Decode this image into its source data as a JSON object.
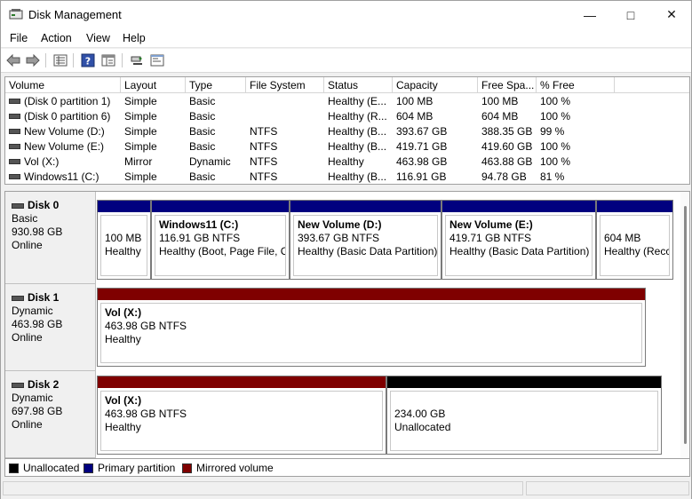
{
  "window": {
    "title": "Disk Management",
    "minimize_glyph": "—",
    "maximize_glyph": "□",
    "close_glyph": "✕"
  },
  "menu": {
    "file": "File",
    "action": "Action",
    "view": "View",
    "help": "Help"
  },
  "toolbar": {
    "icons": [
      "back-icon",
      "forward-icon",
      "list-view-icon",
      "help-icon",
      "properties-icon",
      "connect-icon",
      "console-icon"
    ]
  },
  "volume_list": {
    "columns": [
      "Volume",
      "Layout",
      "Type",
      "File System",
      "Status",
      "Capacity",
      "Free Spa...",
      "% Free"
    ],
    "rows": [
      {
        "volume": "(Disk 0 partition 1)",
        "layout": "Simple",
        "type": "Basic",
        "fs": "",
        "status": "Healthy (E...",
        "capacity": "100 MB",
        "free": "100 MB",
        "pct": "100 %"
      },
      {
        "volume": "(Disk 0 partition 6)",
        "layout": "Simple",
        "type": "Basic",
        "fs": "",
        "status": "Healthy (R...",
        "capacity": "604 MB",
        "free": "604 MB",
        "pct": "100 %"
      },
      {
        "volume": "New Volume (D:)",
        "layout": "Simple",
        "type": "Basic",
        "fs": "NTFS",
        "status": "Healthy (B...",
        "capacity": "393.67 GB",
        "free": "388.35 GB",
        "pct": "99 %"
      },
      {
        "volume": "New Volume (E:)",
        "layout": "Simple",
        "type": "Basic",
        "fs": "NTFS",
        "status": "Healthy (B...",
        "capacity": "419.71 GB",
        "free": "419.60 GB",
        "pct": "100 %"
      },
      {
        "volume": "Vol (X:)",
        "layout": "Mirror",
        "type": "Dynamic",
        "fs": "NTFS",
        "status": "Healthy",
        "capacity": "463.98 GB",
        "free": "463.88 GB",
        "pct": "100 %"
      },
      {
        "volume": "Windows11 (C:)",
        "layout": "Simple",
        "type": "Basic",
        "fs": "NTFS",
        "status": "Healthy (B...",
        "capacity": "116.91 GB",
        "free": "94.78 GB",
        "pct": "81 %"
      }
    ]
  },
  "disks": [
    {
      "name": "Disk 0",
      "type": "Basic",
      "size": "930.98 GB",
      "state": "Online",
      "partitions": [
        {
          "name": "",
          "detail": "100 MB",
          "status": "Healthy",
          "color": "#00007f"
        },
        {
          "name": "Windows11  (C:)",
          "detail": "116.91 GB NTFS",
          "status": "Healthy (Boot, Page File, C",
          "color": "#00007f"
        },
        {
          "name": "New Volume  (D:)",
          "detail": "393.67 GB NTFS",
          "status": "Healthy (Basic Data Partition)",
          "color": "#00007f"
        },
        {
          "name": "New Volume  (E:)",
          "detail": "419.71 GB NTFS",
          "status": "Healthy (Basic Data Partition)",
          "color": "#00007f"
        },
        {
          "name": "",
          "detail": "604 MB",
          "status": "Healthy (Recc",
          "color": "#00007f"
        }
      ]
    },
    {
      "name": "Disk 1",
      "type": "Dynamic",
      "size": "463.98 GB",
      "state": "Online",
      "partitions": [
        {
          "name": "Vol  (X:)",
          "detail": "463.98 GB NTFS",
          "status": "Healthy",
          "color": "#7f0000"
        }
      ]
    },
    {
      "name": "Disk 2",
      "type": "Dynamic",
      "size": "697.98 GB",
      "state": "Online",
      "partitions": [
        {
          "name": "Vol  (X:)",
          "detail": "463.98 GB NTFS",
          "status": "Healthy",
          "color": "#7f0000"
        },
        {
          "name": "",
          "detail": "234.00 GB",
          "status": "Unallocated",
          "color": "#000000"
        }
      ]
    }
  ],
  "legend": [
    {
      "label": "Unallocated",
      "color": "#000000"
    },
    {
      "label": "Primary partition",
      "color": "#00007f"
    },
    {
      "label": "Mirrored volume",
      "color": "#7f0000"
    }
  ]
}
